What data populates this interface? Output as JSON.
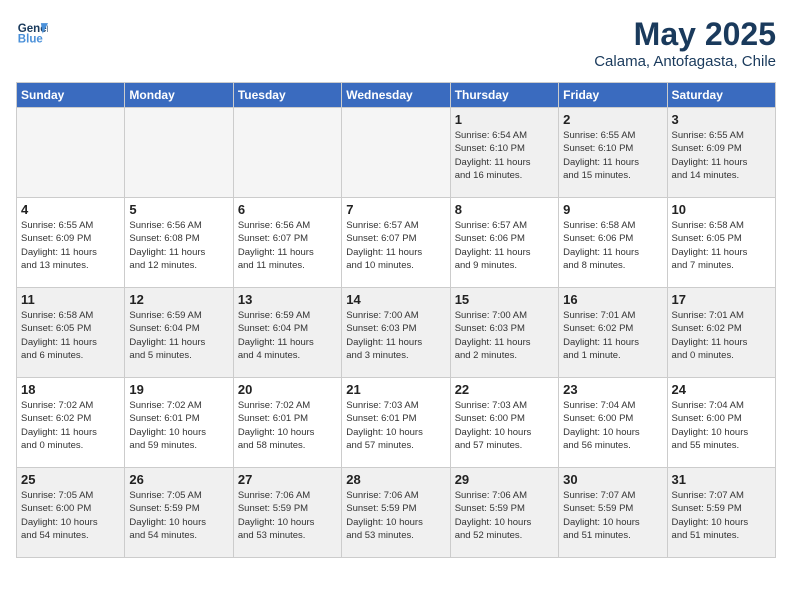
{
  "header": {
    "logo_line1": "General",
    "logo_line2": "Blue",
    "month_title": "May 2025",
    "location": "Calama, Antofagasta, Chile"
  },
  "weekdays": [
    "Sunday",
    "Monday",
    "Tuesday",
    "Wednesday",
    "Thursday",
    "Friday",
    "Saturday"
  ],
  "weeks": [
    [
      {
        "day": "",
        "info": "",
        "empty": true
      },
      {
        "day": "",
        "info": "",
        "empty": true
      },
      {
        "day": "",
        "info": "",
        "empty": true
      },
      {
        "day": "",
        "info": "",
        "empty": true
      },
      {
        "day": "1",
        "info": "Sunrise: 6:54 AM\nSunset: 6:10 PM\nDaylight: 11 hours\nand 16 minutes.",
        "empty": false
      },
      {
        "day": "2",
        "info": "Sunrise: 6:55 AM\nSunset: 6:10 PM\nDaylight: 11 hours\nand 15 minutes.",
        "empty": false
      },
      {
        "day": "3",
        "info": "Sunrise: 6:55 AM\nSunset: 6:09 PM\nDaylight: 11 hours\nand 14 minutes.",
        "empty": false
      }
    ],
    [
      {
        "day": "4",
        "info": "Sunrise: 6:55 AM\nSunset: 6:09 PM\nDaylight: 11 hours\nand 13 minutes.",
        "empty": false
      },
      {
        "day": "5",
        "info": "Sunrise: 6:56 AM\nSunset: 6:08 PM\nDaylight: 11 hours\nand 12 minutes.",
        "empty": false
      },
      {
        "day": "6",
        "info": "Sunrise: 6:56 AM\nSunset: 6:07 PM\nDaylight: 11 hours\nand 11 minutes.",
        "empty": false
      },
      {
        "day": "7",
        "info": "Sunrise: 6:57 AM\nSunset: 6:07 PM\nDaylight: 11 hours\nand 10 minutes.",
        "empty": false
      },
      {
        "day": "8",
        "info": "Sunrise: 6:57 AM\nSunset: 6:06 PM\nDaylight: 11 hours\nand 9 minutes.",
        "empty": false
      },
      {
        "day": "9",
        "info": "Sunrise: 6:58 AM\nSunset: 6:06 PM\nDaylight: 11 hours\nand 8 minutes.",
        "empty": false
      },
      {
        "day": "10",
        "info": "Sunrise: 6:58 AM\nSunset: 6:05 PM\nDaylight: 11 hours\nand 7 minutes.",
        "empty": false
      }
    ],
    [
      {
        "day": "11",
        "info": "Sunrise: 6:58 AM\nSunset: 6:05 PM\nDaylight: 11 hours\nand 6 minutes.",
        "empty": false
      },
      {
        "day": "12",
        "info": "Sunrise: 6:59 AM\nSunset: 6:04 PM\nDaylight: 11 hours\nand 5 minutes.",
        "empty": false
      },
      {
        "day": "13",
        "info": "Sunrise: 6:59 AM\nSunset: 6:04 PM\nDaylight: 11 hours\nand 4 minutes.",
        "empty": false
      },
      {
        "day": "14",
        "info": "Sunrise: 7:00 AM\nSunset: 6:03 PM\nDaylight: 11 hours\nand 3 minutes.",
        "empty": false
      },
      {
        "day": "15",
        "info": "Sunrise: 7:00 AM\nSunset: 6:03 PM\nDaylight: 11 hours\nand 2 minutes.",
        "empty": false
      },
      {
        "day": "16",
        "info": "Sunrise: 7:01 AM\nSunset: 6:02 PM\nDaylight: 11 hours\nand 1 minute.",
        "empty": false
      },
      {
        "day": "17",
        "info": "Sunrise: 7:01 AM\nSunset: 6:02 PM\nDaylight: 11 hours\nand 0 minutes.",
        "empty": false
      }
    ],
    [
      {
        "day": "18",
        "info": "Sunrise: 7:02 AM\nSunset: 6:02 PM\nDaylight: 11 hours\nand 0 minutes.",
        "empty": false
      },
      {
        "day": "19",
        "info": "Sunrise: 7:02 AM\nSunset: 6:01 PM\nDaylight: 10 hours\nand 59 minutes.",
        "empty": false
      },
      {
        "day": "20",
        "info": "Sunrise: 7:02 AM\nSunset: 6:01 PM\nDaylight: 10 hours\nand 58 minutes.",
        "empty": false
      },
      {
        "day": "21",
        "info": "Sunrise: 7:03 AM\nSunset: 6:01 PM\nDaylight: 10 hours\nand 57 minutes.",
        "empty": false
      },
      {
        "day": "22",
        "info": "Sunrise: 7:03 AM\nSunset: 6:00 PM\nDaylight: 10 hours\nand 57 minutes.",
        "empty": false
      },
      {
        "day": "23",
        "info": "Sunrise: 7:04 AM\nSunset: 6:00 PM\nDaylight: 10 hours\nand 56 minutes.",
        "empty": false
      },
      {
        "day": "24",
        "info": "Sunrise: 7:04 AM\nSunset: 6:00 PM\nDaylight: 10 hours\nand 55 minutes.",
        "empty": false
      }
    ],
    [
      {
        "day": "25",
        "info": "Sunrise: 7:05 AM\nSunset: 6:00 PM\nDaylight: 10 hours\nand 54 minutes.",
        "empty": false
      },
      {
        "day": "26",
        "info": "Sunrise: 7:05 AM\nSunset: 5:59 PM\nDaylight: 10 hours\nand 54 minutes.",
        "empty": false
      },
      {
        "day": "27",
        "info": "Sunrise: 7:06 AM\nSunset: 5:59 PM\nDaylight: 10 hours\nand 53 minutes.",
        "empty": false
      },
      {
        "day": "28",
        "info": "Sunrise: 7:06 AM\nSunset: 5:59 PM\nDaylight: 10 hours\nand 53 minutes.",
        "empty": false
      },
      {
        "day": "29",
        "info": "Sunrise: 7:06 AM\nSunset: 5:59 PM\nDaylight: 10 hours\nand 52 minutes.",
        "empty": false
      },
      {
        "day": "30",
        "info": "Sunrise: 7:07 AM\nSunset: 5:59 PM\nDaylight: 10 hours\nand 51 minutes.",
        "empty": false
      },
      {
        "day": "31",
        "info": "Sunrise: 7:07 AM\nSunset: 5:59 PM\nDaylight: 10 hours\nand 51 minutes.",
        "empty": false
      }
    ]
  ]
}
